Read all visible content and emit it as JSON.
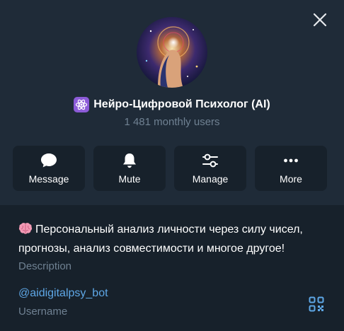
{
  "profile": {
    "name": "Нейро-Цифровой Психолог (AI)",
    "subtitle": "1 481 monthly users",
    "avatar_icon": "ai-woman-avatar-icon"
  },
  "actions": [
    {
      "label": "Message",
      "icon": "chat-bubble-icon"
    },
    {
      "label": "Mute",
      "icon": "bell-icon"
    },
    {
      "label": "Manage",
      "icon": "sliders-icon"
    },
    {
      "label": "More",
      "icon": "more-dots-icon"
    }
  ],
  "info": {
    "description": "Персональный анализ личности через силу чисел, прогнозы, анализ совместимости и многое другое!",
    "description_label": "Description",
    "username": "@aidigitalpsy_bot",
    "username_label": "Username"
  },
  "colors": {
    "background": "#17212b",
    "header": "#1f2b38",
    "accent_link": "#5ea7e6",
    "muted": "#6f8192"
  }
}
